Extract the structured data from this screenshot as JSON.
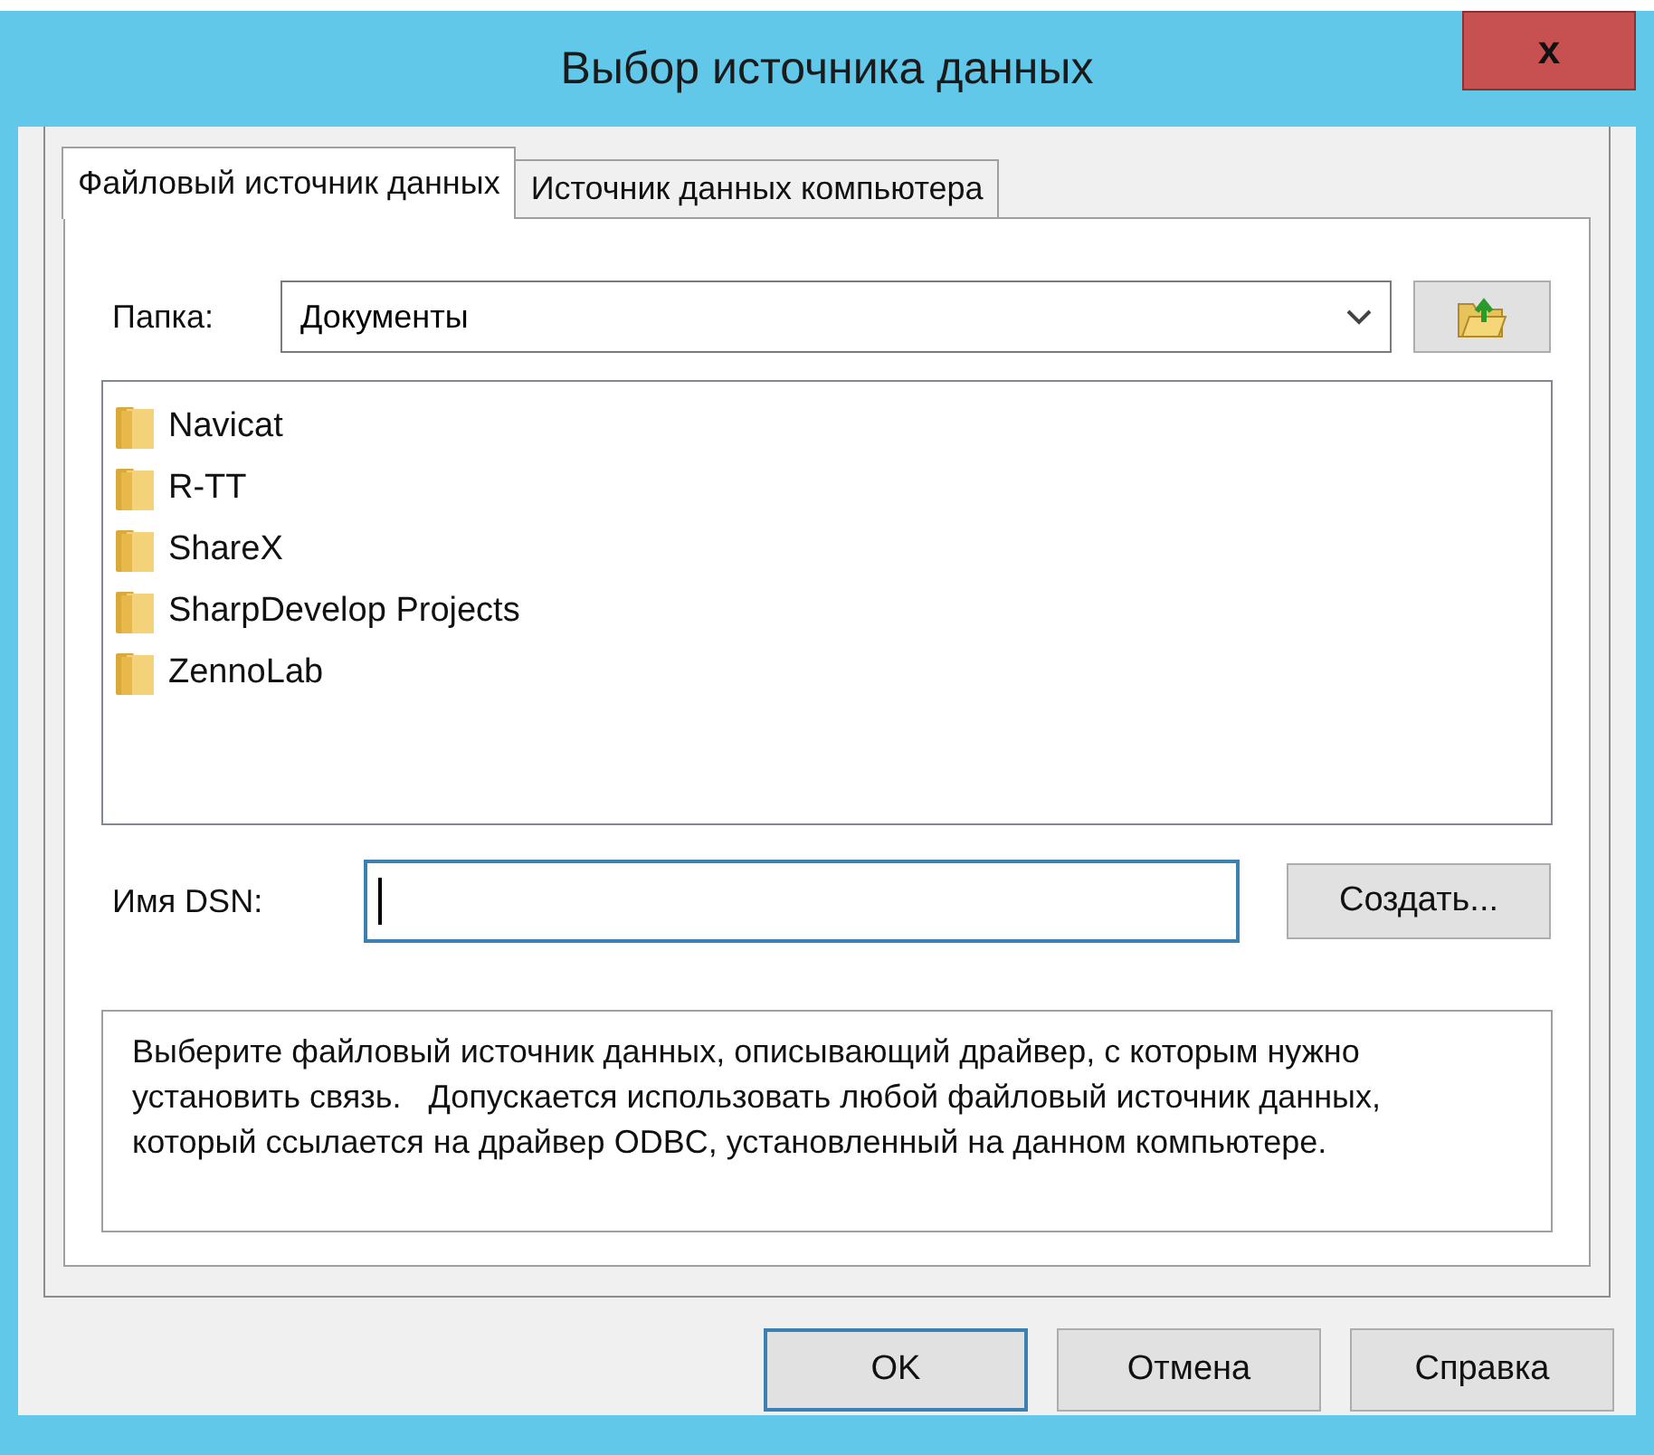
{
  "window": {
    "title": "Выбор источника данных",
    "close": "x"
  },
  "tabs": [
    {
      "label": "Файловый источник данных",
      "selected": true
    },
    {
      "label": "Источник данных компьютера",
      "selected": false
    }
  ],
  "folder": {
    "label": "Папка:",
    "value": "Документы"
  },
  "files": [
    {
      "name": "Navicat",
      "selected": false
    },
    {
      "name": "R-TT",
      "selected": false
    },
    {
      "name": "ShareX",
      "selected": false
    },
    {
      "name": "SharpDevelop Projects",
      "selected": false
    },
    {
      "name": "ZennoLab",
      "selected": false
    }
  ],
  "dsn": {
    "label": "Имя DSN:",
    "create_button": "Создать..."
  },
  "description": "Выберите файловый источник данных, описывающий драйвер, с которым нужно установить связь.   Допускается использовать любой файловый источник данных, который ссылается на драйвер ODBC, установленный на данном компьютере.",
  "buttons": [
    "OK",
    "Отмена",
    "Справка"
  ]
}
